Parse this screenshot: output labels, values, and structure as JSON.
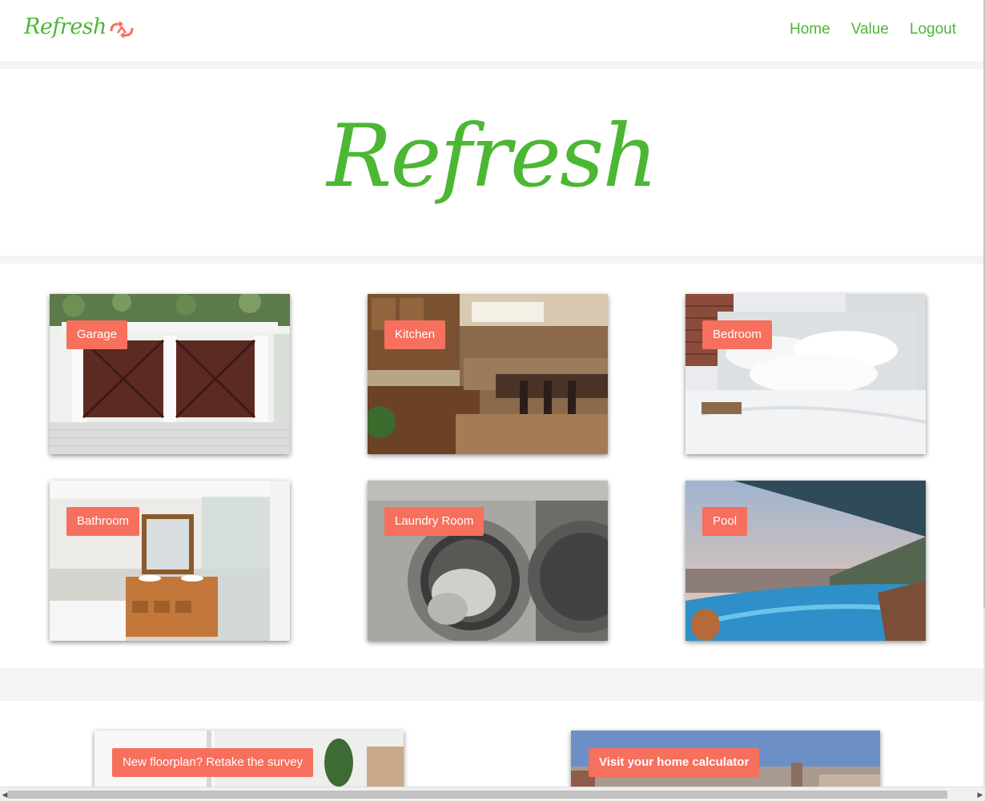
{
  "brand": {
    "name": "Refresh",
    "logo_icon": "refresh-arrows-icon",
    "logo_color": "#f76f5d"
  },
  "nav": {
    "items": [
      {
        "label": "Home"
      },
      {
        "label": "Value"
      },
      {
        "label": "Logout"
      }
    ]
  },
  "hero": {
    "title": "Refresh"
  },
  "rooms": [
    {
      "label": "Garage"
    },
    {
      "label": "Kitchen"
    },
    {
      "label": "Bedroom"
    },
    {
      "label": "Bathroom"
    },
    {
      "label": "Laundry Room"
    },
    {
      "label": "Pool"
    }
  ],
  "actions": [
    {
      "label": "New floorplan? Retake the survey"
    },
    {
      "label": "Visit your home calculator"
    }
  ],
  "colors": {
    "brand_green": "#4cb733",
    "accent_coral": "#f76f5d"
  }
}
